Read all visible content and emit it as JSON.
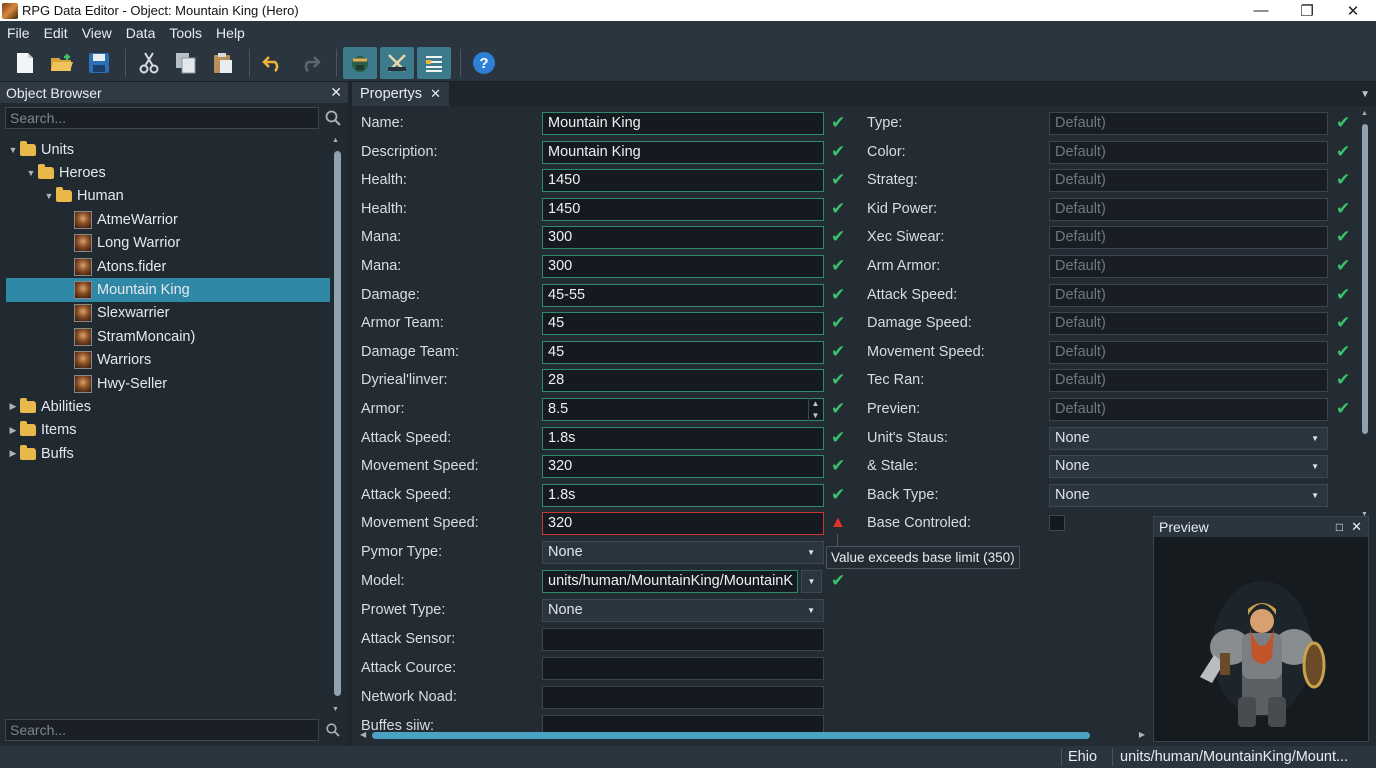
{
  "window": {
    "title": "RPG Data Editor - Object: Mountain King (Hero)"
  },
  "menu": [
    "File",
    "Edit",
    "View",
    "Data",
    "Tools",
    "Help"
  ],
  "toolbar": {
    "icons": [
      "new-file-icon",
      "open-folder-icon",
      "save-icon",
      "cut-icon",
      "copy-icon",
      "paste-icon",
      "undo-icon",
      "redo-icon",
      "unit-tool-icon",
      "ability-tool-icon",
      "list-tool-icon",
      "help-icon"
    ]
  },
  "object_browser": {
    "title": "Object Browser",
    "search_placeholder": "Search...",
    "bottom_search_placeholder": "Search...",
    "tree": [
      {
        "label": "Units",
        "level": 0,
        "kind": "folder",
        "expanded": true
      },
      {
        "label": "Heroes",
        "level": 1,
        "kind": "folder",
        "expanded": true
      },
      {
        "label": "Human",
        "level": 2,
        "kind": "folder",
        "expanded": true
      },
      {
        "label": "AtmeWarrior",
        "level": 3,
        "kind": "unit"
      },
      {
        "label": "Long Warrior",
        "level": 3,
        "kind": "unit"
      },
      {
        "label": "Atons.fider",
        "level": 3,
        "kind": "unit"
      },
      {
        "label": "Mountain King",
        "level": 3,
        "kind": "unit",
        "selected": true
      },
      {
        "label": "Slexwarrier",
        "level": 3,
        "kind": "unit"
      },
      {
        "label": "StramMoncain)",
        "level": 3,
        "kind": "unit"
      },
      {
        "label": "Warriors",
        "level": 3,
        "kind": "unit"
      },
      {
        "label": "Hwy-Seller",
        "level": 3,
        "kind": "unit"
      },
      {
        "label": "Abilities",
        "level": 0,
        "kind": "folder",
        "expanded": false
      },
      {
        "label": "Items",
        "level": 0,
        "kind": "folder",
        "expanded": false
      },
      {
        "label": "Buffs",
        "level": 0,
        "kind": "folder",
        "expanded": false
      }
    ]
  },
  "properties": {
    "tab": "Propertys",
    "left": [
      {
        "label": "Name:",
        "value": "Mountain King",
        "kind": "text",
        "status": "ok"
      },
      {
        "label": "Description:",
        "value": "Mountain King",
        "kind": "text",
        "status": "ok"
      },
      {
        "label": "Health:",
        "value": "1450",
        "kind": "text",
        "status": "ok"
      },
      {
        "label": "Health:",
        "value": "1450",
        "kind": "text",
        "status": "ok"
      },
      {
        "label": "Mana:",
        "value": "300",
        "kind": "text",
        "status": "ok"
      },
      {
        "label": "Mana:",
        "value": "300",
        "kind": "text",
        "status": "ok"
      },
      {
        "label": "Damage:",
        "value": "45-55",
        "kind": "text",
        "status": "ok"
      },
      {
        "label": "Armor Team:",
        "value": "45",
        "kind": "text",
        "status": "ok"
      },
      {
        "label": "Damage Team:",
        "value": "45",
        "kind": "text",
        "status": "ok"
      },
      {
        "label": "Dyrieal'linver:",
        "value": "28",
        "kind": "text",
        "status": "ok"
      },
      {
        "label": "Armor:",
        "value": "8.5",
        "kind": "spin",
        "status": "ok"
      },
      {
        "label": "Attack Speed:",
        "value": "1.8s",
        "kind": "text",
        "status": "ok"
      },
      {
        "label": "Movement Speed:",
        "value": "320",
        "kind": "text",
        "status": "ok"
      },
      {
        "label": "Attack Speed:",
        "value": "1.8s",
        "kind": "text",
        "status": "ok"
      },
      {
        "label": "Movement Speed:",
        "value": "320",
        "kind": "text",
        "status": "error"
      },
      {
        "label": "Pymor Type:",
        "value": "None",
        "kind": "dropdown",
        "status": ""
      },
      {
        "label": "Model:",
        "value": "units/human/MountainKing/MountainK",
        "kind": "model",
        "status": "ok"
      },
      {
        "label": "Prowet Type:",
        "value": "None",
        "kind": "dropdown",
        "status": ""
      },
      {
        "label": "Attack Sensor:",
        "value": "",
        "kind": "text",
        "status": ""
      },
      {
        "label": "Attack Cource:",
        "value": "",
        "kind": "text",
        "status": ""
      },
      {
        "label": "Network Noad:",
        "value": "",
        "kind": "text",
        "status": ""
      },
      {
        "label": "Buffes siiw:",
        "value": "",
        "kind": "text",
        "status": ""
      }
    ],
    "right": [
      {
        "label": "Type:",
        "value": "Default)",
        "kind": "default",
        "status": "ok"
      },
      {
        "label": "Color:",
        "value": "Default)",
        "kind": "default",
        "status": "ok"
      },
      {
        "label": "Strateg:",
        "value": "Default)",
        "kind": "default",
        "status": "ok"
      },
      {
        "label": "Kid Power:",
        "value": "Default)",
        "kind": "default",
        "status": "ok"
      },
      {
        "label": "Xec Siwear:",
        "value": "Default)",
        "kind": "default",
        "status": "ok"
      },
      {
        "label": "Arm Armor:",
        "value": "Default)",
        "kind": "default",
        "status": "ok"
      },
      {
        "label": "Attack Speed:",
        "value": "Default)",
        "kind": "default",
        "status": "ok"
      },
      {
        "label": "Damage Speed:",
        "value": "Default)",
        "kind": "default",
        "status": "ok"
      },
      {
        "label": "Movement Speed:",
        "value": "Default)",
        "kind": "default",
        "status": "ok"
      },
      {
        "label": "Tec Ran:",
        "value": "Default)",
        "kind": "default",
        "status": "ok"
      },
      {
        "label": "Previen:",
        "value": "Default)",
        "kind": "default",
        "status": "ok"
      },
      {
        "label": "Unit's Staus:",
        "value": "None",
        "kind": "dropdown",
        "status": ""
      },
      {
        "label": "& Stale:",
        "value": "None",
        "kind": "dropdown",
        "status": ""
      },
      {
        "label": "Back Type:",
        "value": "None",
        "kind": "dropdown",
        "status": ""
      },
      {
        "label": "Base Controled:",
        "value": "",
        "kind": "checkbox",
        "status": ""
      }
    ],
    "tooltip": "Value exceeds base limit (350)"
  },
  "preview": {
    "title": "Preview"
  },
  "statusbar": {
    "left_text": "Ehio",
    "path": "units/human/MountainKing/Mount..."
  },
  "colors": {
    "accent": "#2f88a6",
    "ok": "#39c26a",
    "error": "#e0342a"
  }
}
